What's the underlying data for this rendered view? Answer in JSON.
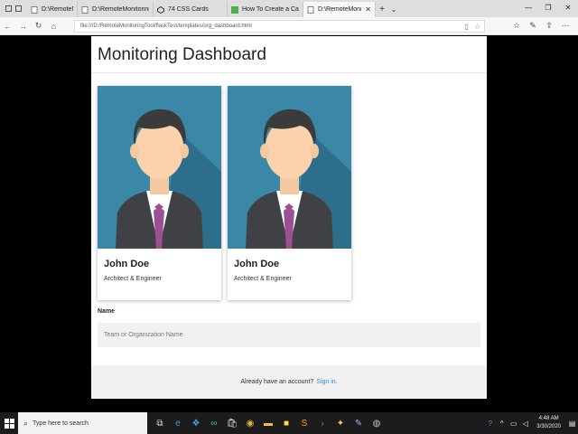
{
  "browser": {
    "tabs": [
      {
        "label": "D:\\RemoteMonitoringTool\\f",
        "icon": "document-icon",
        "active": false
      },
      {
        "label": "D:\\RemoteMonitoringTool\\f",
        "icon": "document-icon",
        "active": false
      },
      {
        "label": "74 CSS Cards",
        "icon": "codepen-icon",
        "active": false
      },
      {
        "label": "How To Create a Card with C",
        "icon": "w3schools-icon",
        "active": false
      },
      {
        "label": "D:\\RemoteMonitoringTc",
        "icon": "document-icon",
        "active": true
      }
    ],
    "new_tab": "+",
    "tab_menu": "⌄",
    "url": "file:///D:/RemoteMonitoringTool/flaskTest/templates/org_dashboard.html"
  },
  "page": {
    "title": "Monitoring Dashboard",
    "cards": [
      {
        "name": "John Doe",
        "role": "Architect & Engineer",
        "image": "avatar-illustration"
      },
      {
        "name": "John Doe",
        "role": "Architect & Engineer",
        "image": "avatar-illustration"
      }
    ],
    "form": {
      "label": "Name",
      "placeholder": "Team or Organization Name"
    },
    "footer": {
      "text": "Already have an account?",
      "link": "Sign in."
    }
  },
  "taskbar": {
    "search_placeholder": "Type here to search",
    "time": "4:48 AM",
    "date": "3/30/2020"
  },
  "colors": {
    "card_bg_top": "#3a87a8",
    "card_bg_bottom": "#2c6e8c",
    "link": "#2b8fd8",
    "input_bg": "#f1f1f1"
  }
}
